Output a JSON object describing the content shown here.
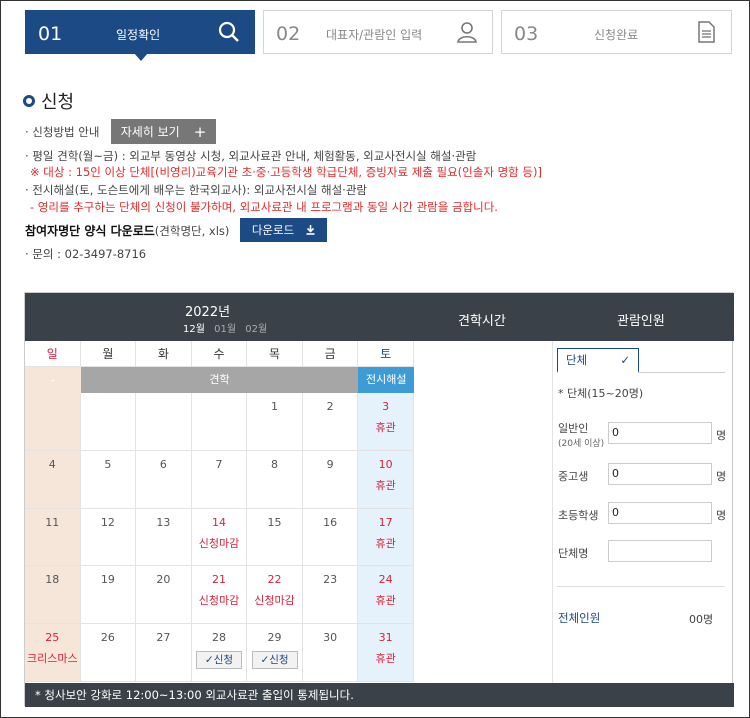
{
  "steps": [
    {
      "num": "01",
      "label": "일정확인"
    },
    {
      "num": "02",
      "label": "대표자/관람인 입력"
    },
    {
      "num": "03",
      "label": "신청완료"
    }
  ],
  "section_title": "신청",
  "info": {
    "method_label": "· 신청방법 안내",
    "detail_button": "자세히 보기",
    "weekday_tour": "· 평일 견학(월~금) : 외교부 동영상 시청, 외교사료관 안내, 체험활동, 외교사전시실 해설·관람",
    "weekday_note": "※ 대상 : 15인 이상 단체[(비영리)교육기관 초·중·고등학생 학급단체, 증빙자료 제출 필요(인솔자 명함 등)]",
    "exhibit": "· 전시해설(토, 도슨트에게 배우는 한국외교사): 외교사전시실 해설·관람",
    "exhibit_note": "- 영리를 추구하는 단체의 신청이 불가하며, 외교사료관 내 프로그램과 동일 시간 관람을 금합니다.",
    "download_bold": "참여자명단 양식 다운로드",
    "download_rest": "(견학명단, xls)",
    "download_button": "다운로드",
    "contact": "· 문의 : 02-3497-8716"
  },
  "calendar": {
    "year": "2022년",
    "months": [
      "12월",
      "01월",
      "02월"
    ],
    "weekdays": [
      "일",
      "월",
      "화",
      "수",
      "목",
      "금",
      "토"
    ],
    "sun_bar": "-",
    "week_bar": "견학",
    "sat_bar": "전시해설",
    "weeks": [
      [
        {
          "d": ""
        },
        {
          "d": ""
        },
        {
          "d": ""
        },
        {
          "d": ""
        },
        {
          "d": "1"
        },
        {
          "d": "2"
        },
        {
          "d": "3",
          "red": true,
          "note": "휴관"
        }
      ],
      [
        {
          "d": "4"
        },
        {
          "d": "5"
        },
        {
          "d": "6"
        },
        {
          "d": "7"
        },
        {
          "d": "8"
        },
        {
          "d": "9"
        },
        {
          "d": "10",
          "red": true,
          "note": "휴관"
        }
      ],
      [
        {
          "d": "11"
        },
        {
          "d": "12"
        },
        {
          "d": "13"
        },
        {
          "d": "14",
          "red": true,
          "note": "신청마감"
        },
        {
          "d": "15"
        },
        {
          "d": "16"
        },
        {
          "d": "17",
          "red": true,
          "note": "휴관"
        }
      ],
      [
        {
          "d": "18"
        },
        {
          "d": "19"
        },
        {
          "d": "20"
        },
        {
          "d": "21",
          "red": true,
          "note": "신청마감"
        },
        {
          "d": "22",
          "red": true,
          "note": "신청마감"
        },
        {
          "d": "23"
        },
        {
          "d": "24",
          "red": true,
          "note": "휴관"
        }
      ],
      [
        {
          "d": "25",
          "red": true,
          "note": "크리스마스"
        },
        {
          "d": "26"
        },
        {
          "d": "27"
        },
        {
          "d": "28",
          "chip": "✓신청"
        },
        {
          "d": "29",
          "chip": "✓신청"
        },
        {
          "d": "30"
        },
        {
          "d": "31",
          "red": true,
          "note": "휴관"
        }
      ]
    ]
  },
  "columns": {
    "time": "견학시간",
    "people": "관람인원"
  },
  "people": {
    "tab": "단체",
    "tab_check": "✓",
    "subtitle": "* 단체(15~20명)",
    "general_label": "일반인",
    "general_sub": "(20세 이상)",
    "general_value": "0",
    "middle_label": "중고생",
    "middle_value": "0",
    "elementary_label": "초등학생",
    "elementary_value": "0",
    "unit": "명",
    "group_name_label": "단체명",
    "group_name_value": "",
    "total_label": "전체인원",
    "total_value": "00명"
  },
  "notice": "* 청사보안 강화로 12:00~13:00 외교사료관 출입이 통제됩니다.",
  "colors": {
    "primary": "#1b4a85",
    "header": "#3a4148",
    "saturday": "#3d9bd6",
    "red": "#d9223a"
  }
}
